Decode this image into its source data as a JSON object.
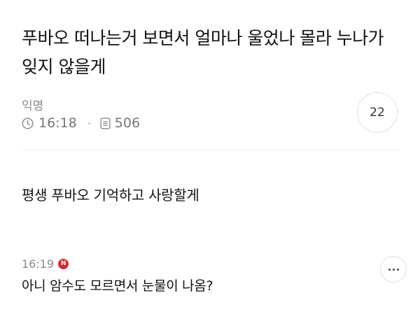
{
  "post": {
    "title": "푸바오 떠나는거 보면서 얼마나 울었나 몰라 누나가 잊지 않을게",
    "author": "익명",
    "time": "16:18",
    "views": "506",
    "comment_count": "22",
    "body": "평생 푸바오 기억하고 사랑할게"
  },
  "comments": [
    {
      "time": "16:19",
      "badge": "N",
      "text": "아니 암수도 모르면서 눈물이 나옴?"
    }
  ],
  "icons": {
    "clock": "clock-icon",
    "views": "document-icon",
    "more": "more-dots-icon",
    "new": "new-badge"
  },
  "colors": {
    "new_badge": "#d9282f",
    "meta_text": "#888888"
  }
}
